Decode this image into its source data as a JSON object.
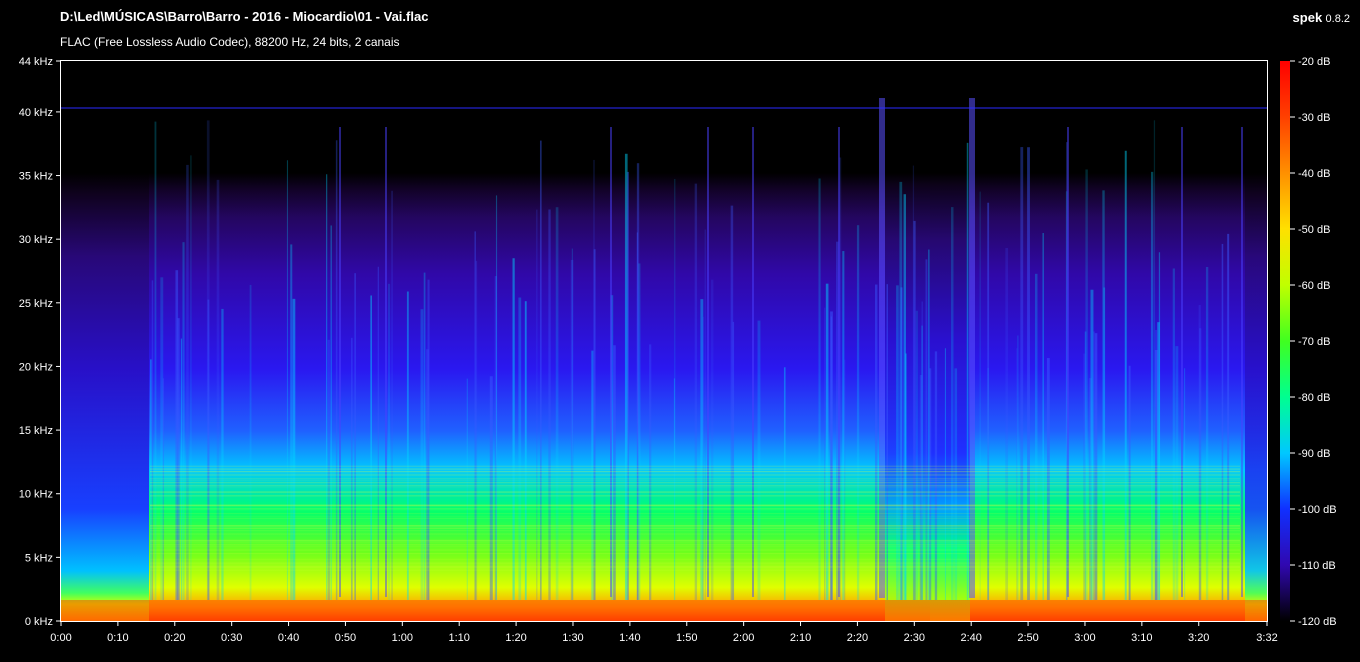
{
  "header": {
    "file_path": "D:\\Led\\MÚSICAS\\Barro\\Barro - 2016 - Miocardio\\01 - Vai.flac",
    "codec_info": "FLAC (Free Lossless Audio Codec), 88200 Hz, 24 bits, 2 canais",
    "app_name": "spek",
    "app_version": "0.8.2"
  },
  "colors": {
    "background": "#000000",
    "axis": "#ffffff",
    "colormap": [
      "#000000",
      "#1a0030",
      "#3a0a8a",
      "#2a20ff",
      "#00c8ff",
      "#00ff40",
      "#c8ff00",
      "#ffd000",
      "#ff6000",
      "#ff0000"
    ]
  },
  "y_axis": {
    "labels": [
      "44 kHz",
      "40 kHz",
      "35 kHz",
      "30 kHz",
      "25 kHz",
      "20 kHz",
      "15 kHz",
      "10 kHz",
      "5 kHz",
      "0 kHz"
    ],
    "values_khz": [
      44,
      40,
      35,
      30,
      25,
      20,
      15,
      10,
      5,
      0
    ],
    "max_khz": 44
  },
  "x_axis": {
    "labels": [
      "0:00",
      "0:10",
      "0:20",
      "0:30",
      "0:40",
      "0:50",
      "1:00",
      "1:10",
      "1:20",
      "1:30",
      "1:40",
      "1:50",
      "2:00",
      "2:10",
      "2:20",
      "2:30",
      "2:40",
      "2:50",
      "3:00",
      "3:10",
      "3:20",
      "3:32"
    ],
    "values_s": [
      0,
      10,
      20,
      30,
      40,
      50,
      60,
      70,
      80,
      90,
      100,
      110,
      120,
      130,
      140,
      150,
      160,
      170,
      180,
      190,
      200,
      212
    ],
    "duration_s": 212
  },
  "db_scale": {
    "labels": [
      "-20 dB",
      "-30 dB",
      "-40 dB",
      "-50 dB",
      "-60 dB",
      "-70 dB",
      "-80 dB",
      "-90 dB",
      "-100 dB",
      "-110 dB",
      "-120 dB"
    ],
    "values_db": [
      -20,
      -30,
      -40,
      -50,
      -60,
      -70,
      -80,
      -90,
      -100,
      -110,
      -120
    ],
    "max_db": -20,
    "min_db": -120
  }
}
